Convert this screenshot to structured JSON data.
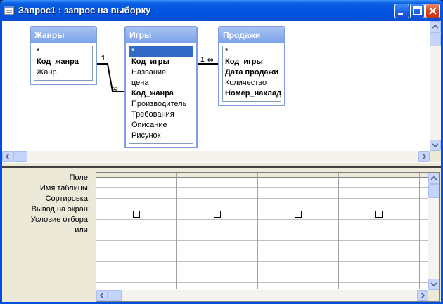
{
  "window": {
    "title": "Запрос1 : запрос на выборку"
  },
  "tables": [
    {
      "title": "Жанры",
      "fields": [
        {
          "label": "*",
          "bold": false
        },
        {
          "label": "Код_жанра",
          "bold": true
        },
        {
          "label": "Жанр",
          "bold": false
        }
      ]
    },
    {
      "title": "Игры",
      "fields": [
        {
          "label": "*",
          "bold": false,
          "selected": true
        },
        {
          "label": "Код_игры",
          "bold": true
        },
        {
          "label": "Название",
          "bold": false
        },
        {
          "label": "цена",
          "bold": false
        },
        {
          "label": "Код_жанра",
          "bold": true
        },
        {
          "label": "Производитель",
          "bold": false
        },
        {
          "label": "Требования",
          "bold": false
        },
        {
          "label": "Описание",
          "bold": false
        },
        {
          "label": "Рисунок",
          "bold": false
        }
      ]
    },
    {
      "title": "Продажи",
      "fields": [
        {
          "label": "*",
          "bold": false
        },
        {
          "label": "Код_игры",
          "bold": true
        },
        {
          "label": "Дата продажи",
          "bold": true
        },
        {
          "label": "Количество",
          "bold": false
        },
        {
          "label": "Номер_накладной",
          "bold": true
        }
      ]
    }
  ],
  "relations": [
    {
      "one": "1",
      "many": "∞"
    },
    {
      "one": "1",
      "many": "∞"
    }
  ],
  "grid": {
    "row_labels": [
      "Поле:",
      "Имя таблицы:",
      "Сортировка:",
      "Вывод на экран:",
      "Условие отбора:",
      "или:"
    ],
    "columns": 4
  },
  "colors": {
    "title_bar": "#0054e3",
    "selection": "#316ac5",
    "table_header": "#7ca3ea"
  },
  "icons": {
    "window": "query-icon",
    "minimize": "minimize-icon",
    "maximize": "maximize-icon",
    "close": "close-icon"
  }
}
